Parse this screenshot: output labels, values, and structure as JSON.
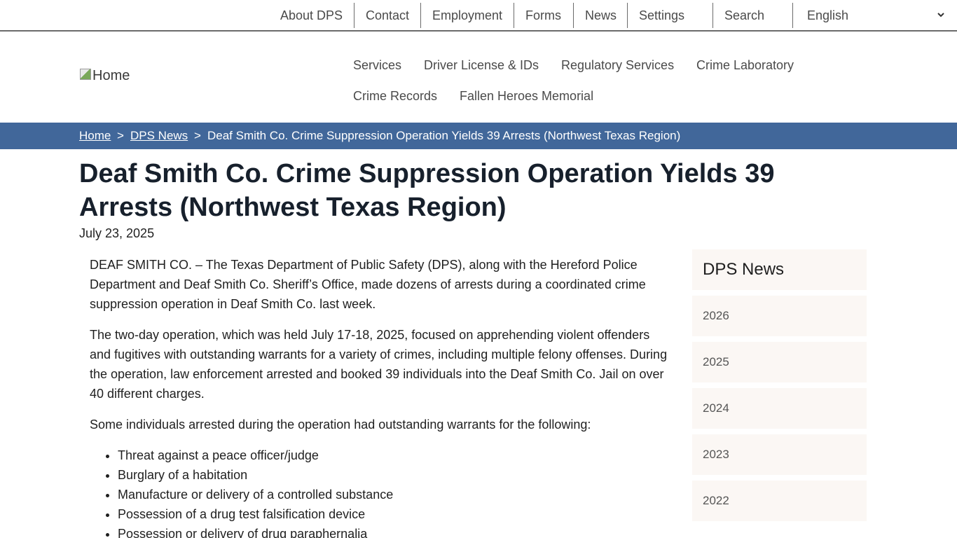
{
  "utility_nav": {
    "items": [
      "About DPS",
      "Contact",
      "Employment",
      "Forms",
      "News",
      "Settings",
      "Search"
    ],
    "language": "English"
  },
  "logo": {
    "alt": "Home"
  },
  "main_nav": {
    "items": [
      "Services",
      "Driver License & IDs",
      "Regulatory Services",
      "Crime Laboratory",
      "Crime Records",
      "Fallen Heroes Memorial"
    ]
  },
  "breadcrumb": {
    "home": "Home",
    "separator": ">",
    "section": "DPS News",
    "current": "Deaf Smith Co. Crime Suppression Operation Yields 39 Arrests (Northwest Texas Region)"
  },
  "article": {
    "title": "Deaf Smith Co. Crime Suppression Operation Yields 39 Arrests (Northwest Texas Region)",
    "date": "July 23, 2025",
    "paragraphs": [
      "DEAF SMITH CO. – The Texas Department of Public Safety (DPS), along with the Hereford Police Department and Deaf Smith Co. Sheriff’s Office, made dozens of arrests during a coordinated crime suppression operation in Deaf Smith Co. last week.",
      "The two-day operation, which was held July 17-18, 2025, focused on apprehending violent offenders and fugitives with outstanding warrants for a variety of crimes, including multiple felony offenses. During the operation, law enforcement arrested and booked 39 individuals into the Deaf Smith Co. Jail on over 40 different charges.",
      "Some individuals arrested during the operation had outstanding warrants for the following:"
    ],
    "list": [
      "Threat against a peace officer/judge",
      "Burglary of a habitation",
      "Manufacture or delivery of a controlled substance",
      "Possession of a drug test falsification device",
      "Possession or delivery of drug paraphernalia"
    ]
  },
  "sidebar": {
    "heading": "DPS News",
    "years": [
      "2026",
      "2025",
      "2024",
      "2023",
      "2022"
    ]
  },
  "colors": {
    "breadcrumb_bg": "#41679a",
    "sidebar_bg": "#fbf7f4",
    "title_text": "#17202c",
    "nav_text": "#4a4a4a"
  }
}
